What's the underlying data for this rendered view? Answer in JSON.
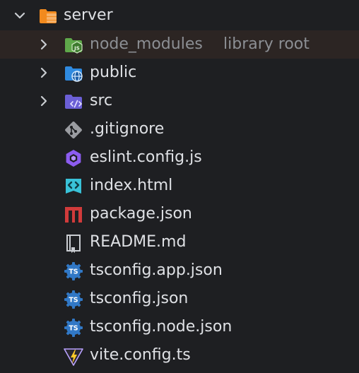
{
  "tree": {
    "root": {
      "label": "server",
      "icon": "folder-server-icon",
      "expanded": true
    },
    "items": [
      {
        "label": "node_modules",
        "suffix": "library root",
        "icon": "folder-node-js-icon",
        "expandable": true
      },
      {
        "label": "public",
        "icon": "folder-public-globe-icon",
        "expandable": true
      },
      {
        "label": "src",
        "icon": "folder-src-code-icon",
        "expandable": true
      },
      {
        "label": ".gitignore",
        "icon": "git-icon"
      },
      {
        "label": "eslint.config.js",
        "icon": "eslint-icon"
      },
      {
        "label": "index.html",
        "icon": "html-icon"
      },
      {
        "label": "package.json",
        "icon": "npm-icon"
      },
      {
        "label": "README.md",
        "icon": "readme-book-icon"
      },
      {
        "label": "tsconfig.app.json",
        "icon": "tsconfig-icon"
      },
      {
        "label": "tsconfig.json",
        "icon": "tsconfig-icon"
      },
      {
        "label": "tsconfig.node.json",
        "icon": "tsconfig-icon"
      },
      {
        "label": "vite.config.ts",
        "icon": "vite-icon"
      }
    ]
  },
  "colors": {
    "background": "#1e1f22",
    "selected_row": "#2c2523",
    "text": "#dfe1e5",
    "dim_text": "#8c8f94",
    "folder_orange": "#f28a1e",
    "folder_green": "#5fa84a",
    "folder_blue": "#2f8ae0",
    "folder_purple": "#6b5fd6",
    "ts_blue": "#3178c6",
    "npm_red": "#d13b3b",
    "eslint_purple": "#8c5cf0",
    "html_cyan": "#39c2d8"
  }
}
